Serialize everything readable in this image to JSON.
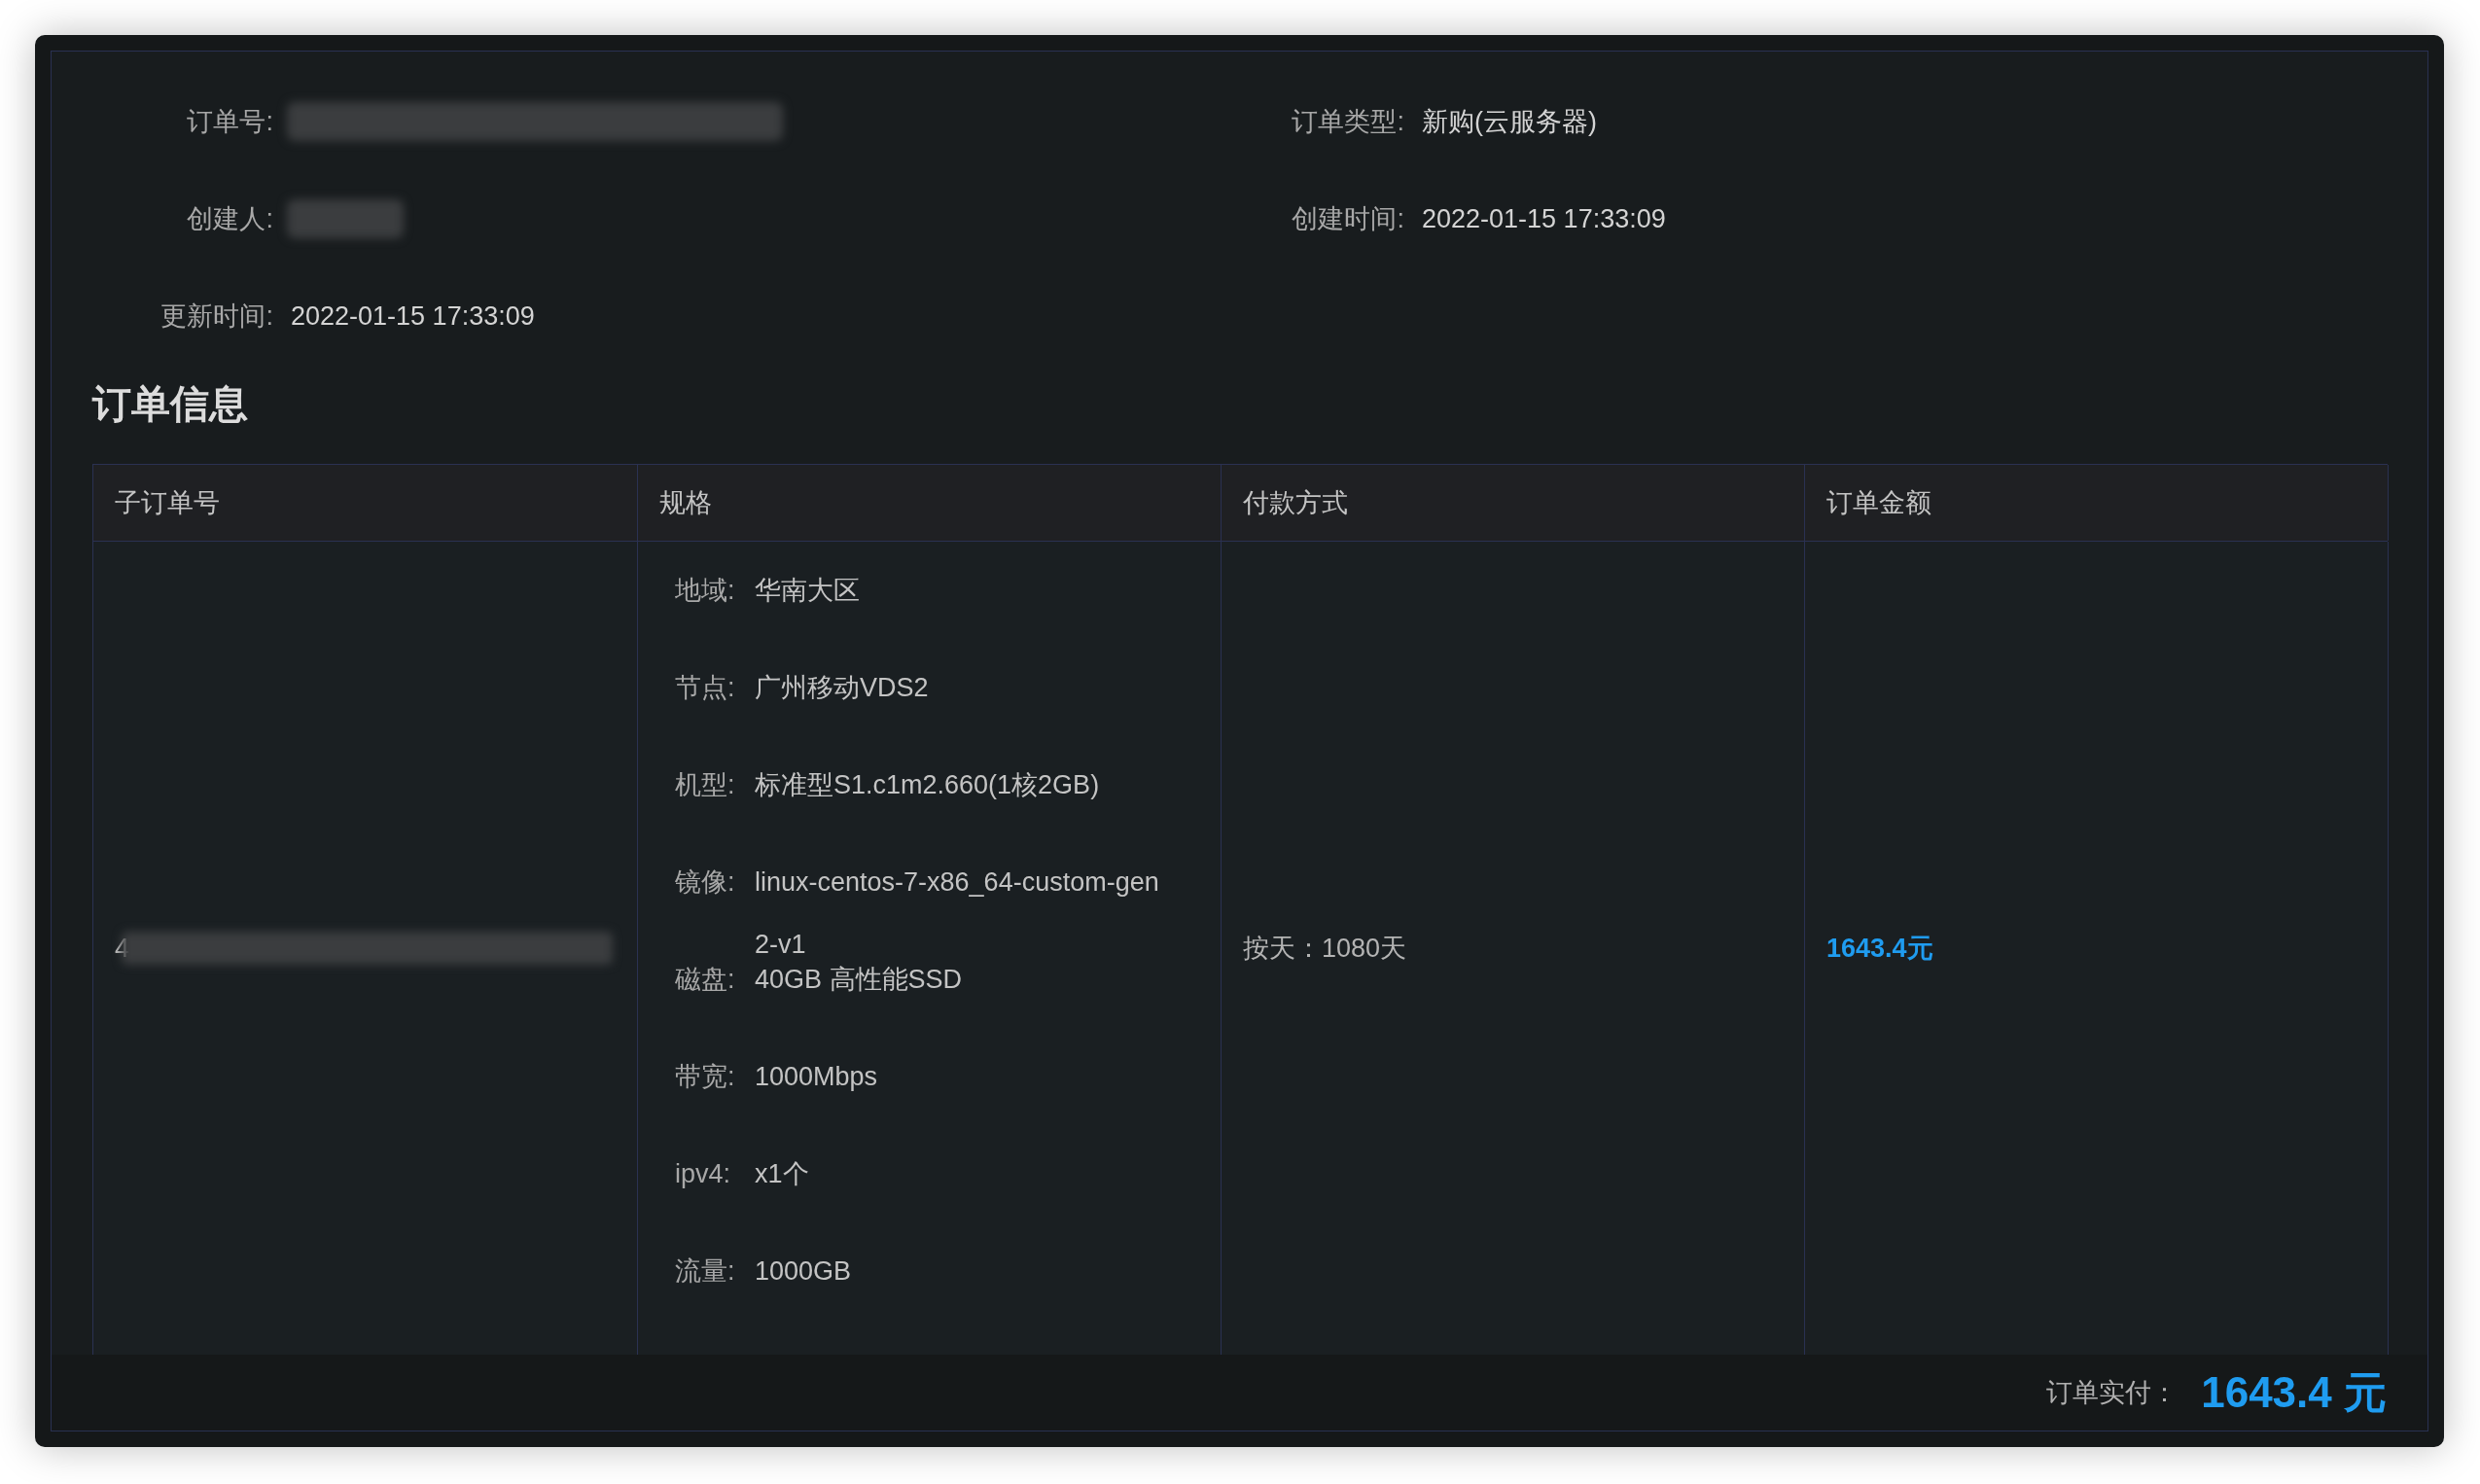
{
  "details": [
    {
      "label": "订单号:",
      "kind": "redacted_long"
    },
    {
      "label": "订单类型:",
      "kind": "text",
      "value": "新购(云服务器)"
    },
    {
      "label": "创建人:",
      "kind": "redacted_short"
    },
    {
      "label": "创建时间:",
      "kind": "text",
      "value": "2022-01-15 17:33:09"
    },
    {
      "label": "更新时间:",
      "kind": "text",
      "value": "2022-01-15 17:33:09"
    }
  ],
  "section_title": "订单信息",
  "table": {
    "columns": [
      "子订单号",
      "规格",
      "付款方式",
      "订单金额"
    ],
    "rows": [
      {
        "sub_order": {
          "visible": "4",
          "kind": "redacted"
        },
        "specs": [
          {
            "label": "地域:",
            "value": "华南大区"
          },
          {
            "label": "节点:",
            "value": "广州移动VDS2"
          },
          {
            "label": "机型:",
            "value": "标准型S1.c1m2.660(1核2GB)"
          },
          {
            "label": "镜像:",
            "value": "linux-centos-7-x86_64-custom-gen2-v1"
          },
          {
            "label": "磁盘:",
            "value": "40GB 高性能SSD"
          },
          {
            "label": "带宽:",
            "value": "1000Mbps"
          },
          {
            "label": "ipv4:",
            "value": "x1个"
          },
          {
            "label": "流量:",
            "value": "1000GB"
          }
        ],
        "payment": "按天：1080天",
        "amount": "1643.4元"
      }
    ]
  },
  "total": {
    "label": "订单实付：",
    "value": "1643.4 元"
  }
}
